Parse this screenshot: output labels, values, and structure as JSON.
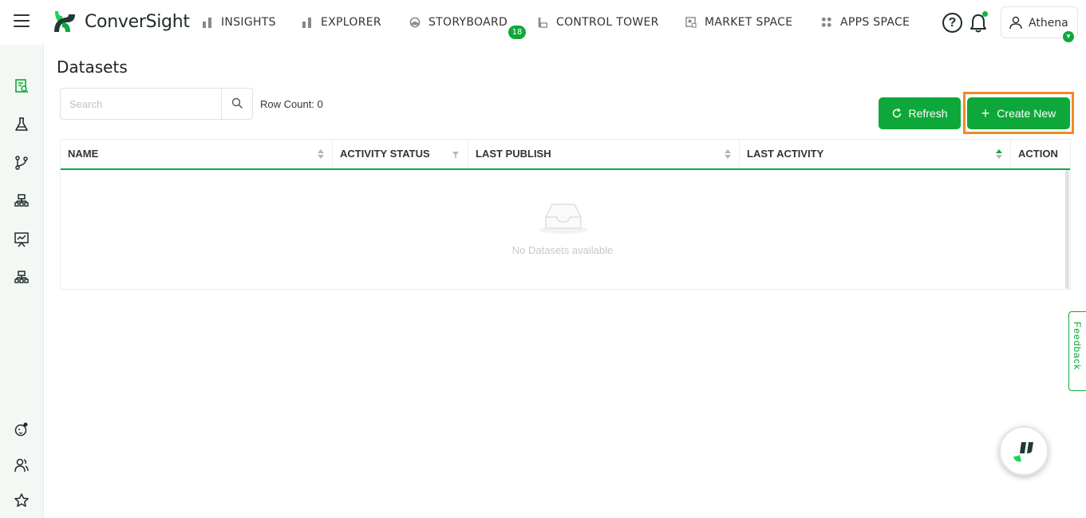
{
  "app": {
    "name": "ConverSight",
    "brand_color": "#0ea83a"
  },
  "topnav": {
    "items": [
      {
        "label": "INSIGHTS",
        "icon": "bar-chart-icon"
      },
      {
        "label": "EXPLORER",
        "icon": "bar-chart-icon"
      },
      {
        "label": "STORYBOARD",
        "icon": "storyboard-icon",
        "badge": "18"
      },
      {
        "label": "CONTROL TOWER",
        "icon": "control-tower-icon"
      },
      {
        "label": "MARKET SPACE",
        "icon": "market-space-icon"
      },
      {
        "label": "APPS SPACE",
        "icon": "apps-grid-icon"
      }
    ],
    "help_label": "?",
    "user_name": "Athena"
  },
  "sidebar": {
    "items": [
      {
        "icon": "dataset-icon",
        "active": true
      },
      {
        "icon": "flask-icon"
      },
      {
        "icon": "git-branch-icon"
      },
      {
        "icon": "hierarchy-icon"
      },
      {
        "icon": "presentation-chart-icon"
      },
      {
        "icon": "hierarchy-icon"
      },
      {
        "icon": "bot-icon"
      },
      {
        "icon": "users-icon"
      },
      {
        "icon": "star-icon"
      }
    ]
  },
  "page": {
    "title": "Datasets",
    "search_placeholder": "Search",
    "row_count": "Row Count: 0",
    "refresh_label": "Refresh",
    "create_label": "Create New"
  },
  "table": {
    "columns": [
      "NAME",
      "ACTIVITY STATUS",
      "LAST PUBLISH",
      "LAST ACTIVITY",
      "ACTION"
    ],
    "empty_text": "No Datasets available",
    "rows": []
  },
  "feedback_label": "Feedback"
}
